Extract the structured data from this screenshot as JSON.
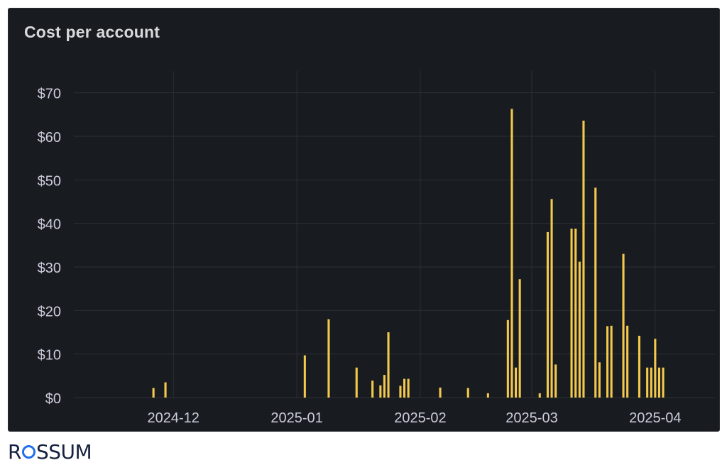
{
  "panel": {
    "title": "Cost per account"
  },
  "chart_data": {
    "type": "bar",
    "title": "Cost per account",
    "xlabel": "",
    "ylabel": "",
    "ylim": [
      0,
      75
    ],
    "yticks": [
      0,
      10,
      20,
      30,
      40,
      50,
      60,
      70
    ],
    "ytick_labels": [
      "$0",
      "$10",
      "$20",
      "$30",
      "$40",
      "$50",
      "$60",
      "$70"
    ],
    "x_axis": {
      "type": "date",
      "start": "2024-11-06",
      "end": "2025-04-16"
    },
    "xticks": [
      "2024-12-01",
      "2025-01-01",
      "2025-02-01",
      "2025-03-01",
      "2025-04-01"
    ],
    "xtick_labels": [
      "2024-12",
      "2025-01",
      "2025-02",
      "2025-03",
      "2025-04"
    ],
    "grid": true,
    "bar_color": "#f2c94c",
    "series": [
      {
        "points": [
          [
            "2024-11-26",
            2.2
          ],
          [
            "2024-11-29",
            3.5
          ],
          [
            "2025-01-03",
            9.7
          ],
          [
            "2025-01-09",
            18.0
          ],
          [
            "2025-01-16",
            6.9
          ],
          [
            "2025-01-20",
            3.9
          ],
          [
            "2025-01-22",
            2.8
          ],
          [
            "2025-01-23",
            5.2
          ],
          [
            "2025-01-24",
            15.0
          ],
          [
            "2025-01-27",
            2.7
          ],
          [
            "2025-01-28",
            4.3
          ],
          [
            "2025-01-29",
            4.3
          ],
          [
            "2025-02-06",
            2.3
          ],
          [
            "2025-02-13",
            2.2
          ],
          [
            "2025-02-18",
            1.0
          ],
          [
            "2025-02-23",
            17.8
          ],
          [
            "2025-02-24",
            66.3
          ],
          [
            "2025-02-25",
            6.9
          ],
          [
            "2025-02-26",
            27.2
          ],
          [
            "2025-03-03",
            1.0
          ],
          [
            "2025-03-05",
            38.0
          ],
          [
            "2025-03-06",
            45.6
          ],
          [
            "2025-03-07",
            7.6
          ],
          [
            "2025-03-11",
            38.8
          ],
          [
            "2025-03-12",
            38.8
          ],
          [
            "2025-03-13",
            31.2
          ],
          [
            "2025-03-14",
            63.6
          ],
          [
            "2025-03-17",
            48.2
          ],
          [
            "2025-03-18",
            8.1
          ],
          [
            "2025-03-20",
            16.4
          ],
          [
            "2025-03-21",
            16.5
          ],
          [
            "2025-03-24",
            33.0
          ],
          [
            "2025-03-25",
            16.5
          ],
          [
            "2025-03-28",
            14.2
          ],
          [
            "2025-03-30",
            6.9
          ],
          [
            "2025-03-31",
            6.9
          ],
          [
            "2025-04-01",
            13.5
          ],
          [
            "2025-04-02",
            6.9
          ],
          [
            "2025-04-03",
            6.9
          ]
        ]
      }
    ]
  },
  "footer": {
    "brand_left": "R",
    "brand_right": "SSUM"
  }
}
